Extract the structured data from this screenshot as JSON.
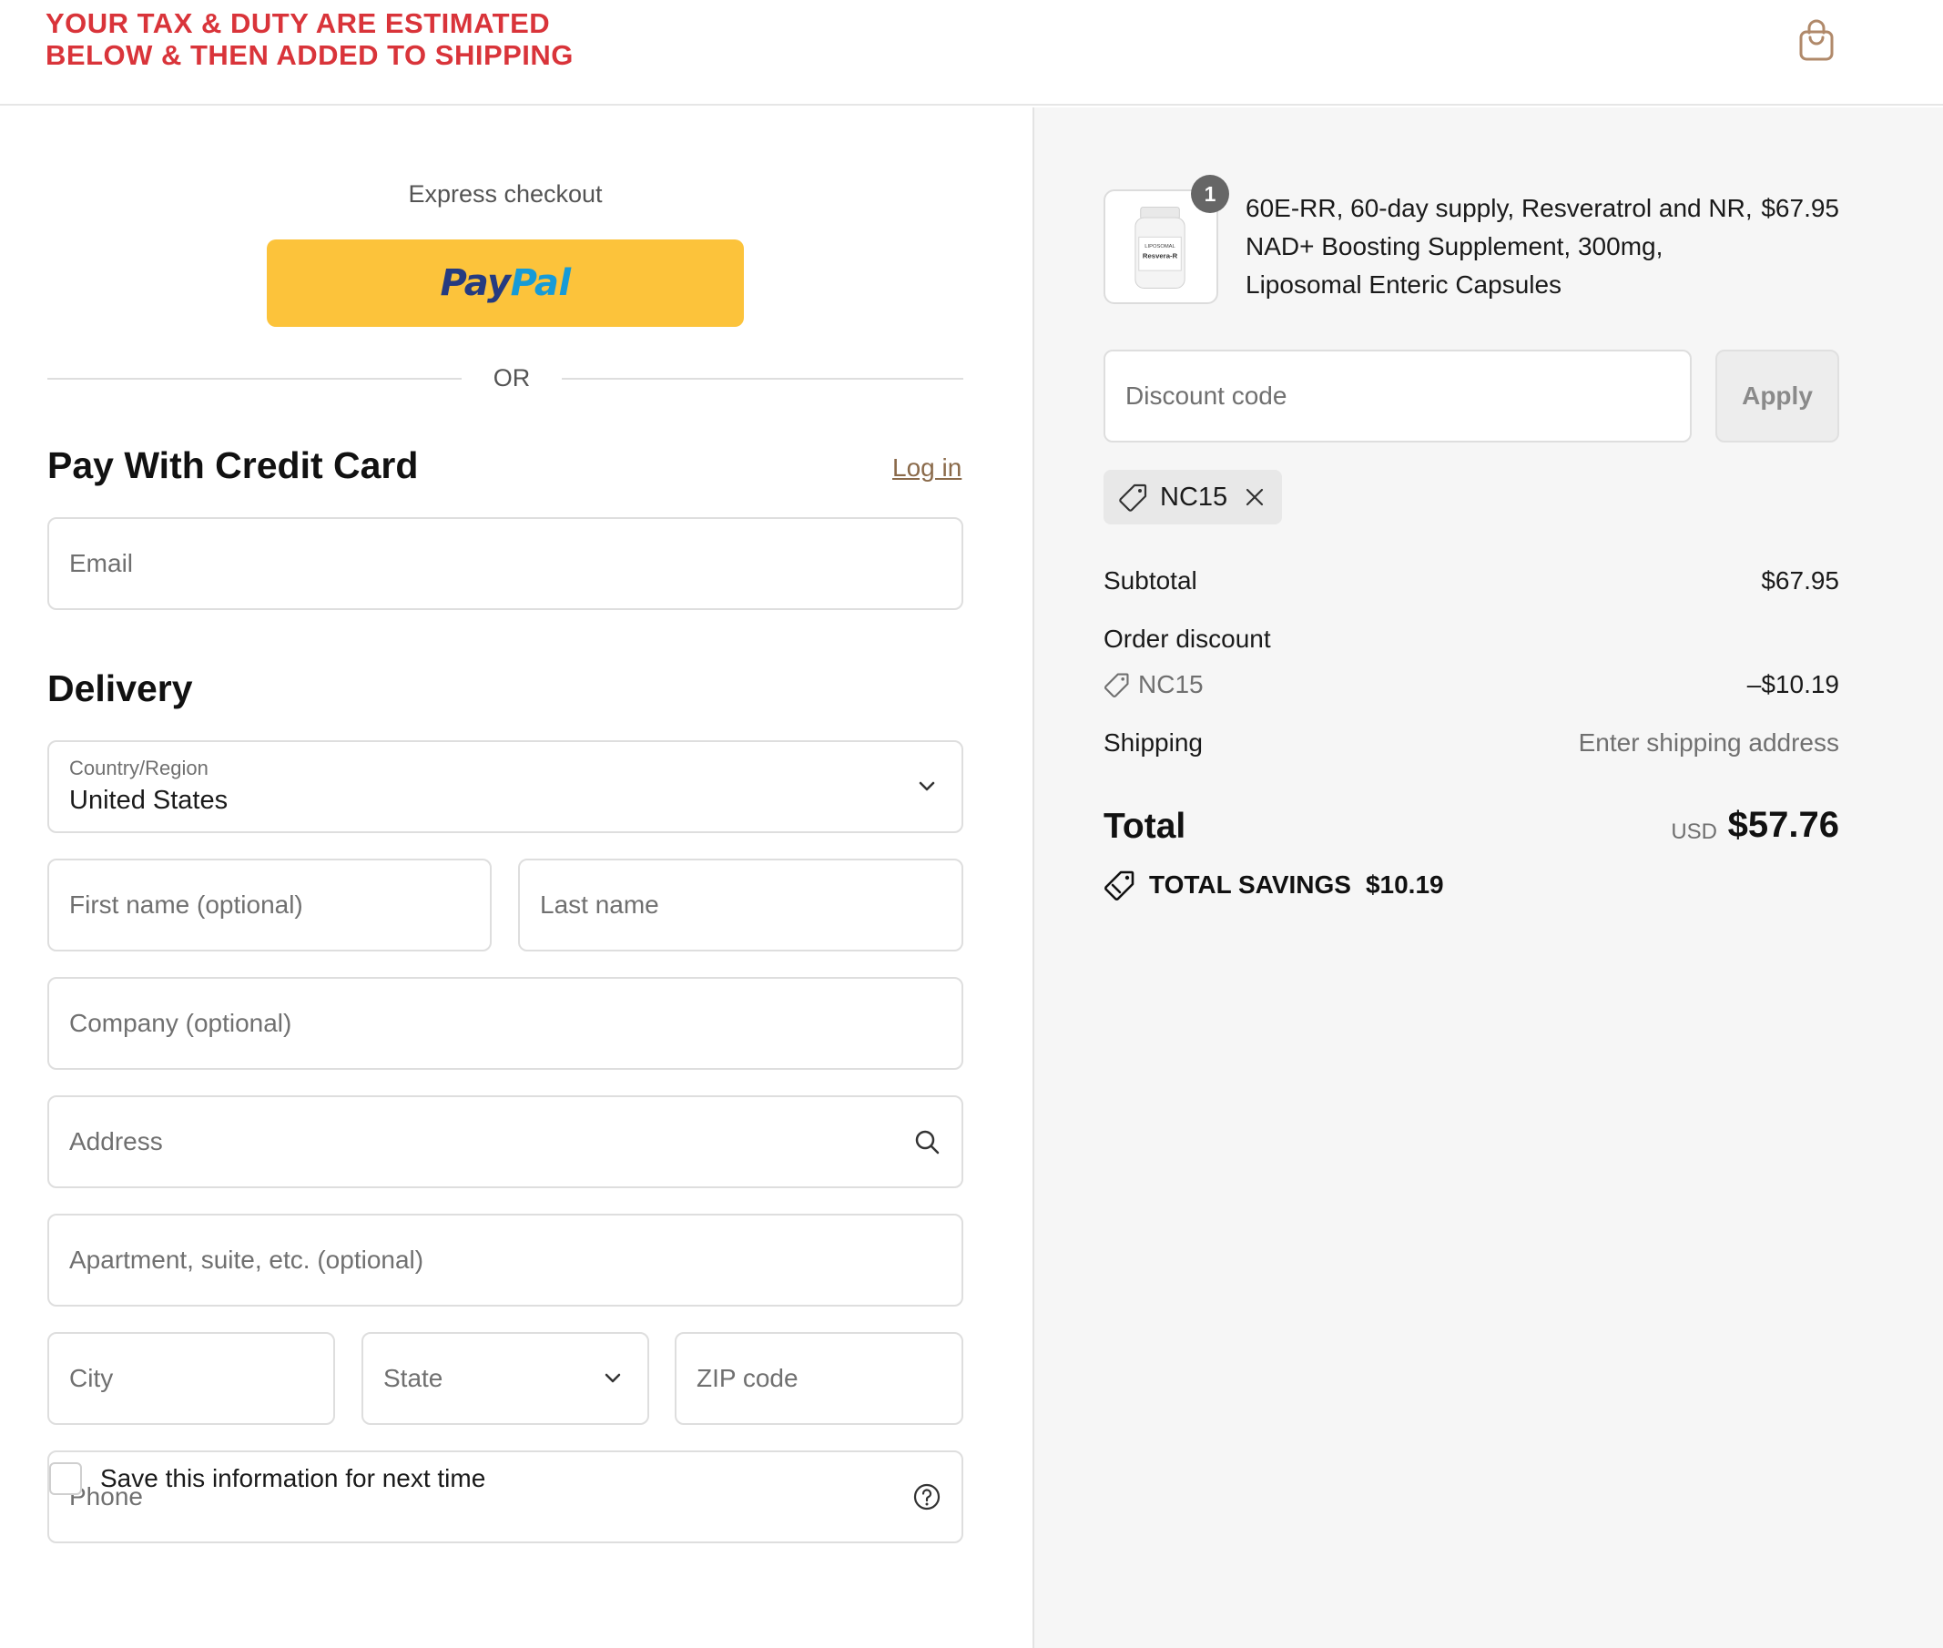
{
  "header": {
    "banner_line1": "YOUR TAX & DUTY ARE ESTIMATED",
    "banner_line2": "BELOW & THEN ADDED TO SHIPPING",
    "cart_icon": "shopping-bag-icon"
  },
  "checkout": {
    "express_label": "Express checkout",
    "paypal_pay": "Pay",
    "paypal_pal": "Pal",
    "or_label": "OR",
    "pay_title": "Pay With Credit Card",
    "login_label": "Log in",
    "email_placeholder": "Email",
    "delivery_title": "Delivery",
    "country_label": "Country/Region",
    "country_value": "United States",
    "first_name_placeholder": "First name (optional)",
    "last_name_placeholder": "Last name",
    "company_placeholder": "Company (optional)",
    "address_placeholder": "Address",
    "apartment_placeholder": "Apartment, suite, etc. (optional)",
    "city_placeholder": "City",
    "state_placeholder": "State",
    "zip_placeholder": "ZIP code",
    "phone_placeholder": "Phone",
    "save_info_label": "Save this information for next time",
    "save_info_checked": false
  },
  "summary": {
    "product": {
      "quantity": "1",
      "name": "60E-RR, 60-day supply, Resveratrol and NR, NAD+ Boosting Supplement, 300mg, Liposomal Enteric Capsules",
      "price": "$67.95",
      "bottle_label_line1": "LIPOSOMAL",
      "bottle_label_line2": "Resvera-R"
    },
    "discount_placeholder": "Discount code",
    "apply_label": "Apply",
    "applied_code": "NC15",
    "subtotal_label": "Subtotal",
    "subtotal_value": "$67.95",
    "order_discount_label": "Order discount",
    "discount_code_line": "NC15",
    "discount_value": "–$10.19",
    "shipping_label": "Shipping",
    "shipping_value": "Enter shipping address",
    "total_label": "Total",
    "total_currency": "USD",
    "total_value": "$57.76",
    "savings_label": "TOTAL SAVINGS",
    "savings_value": "$10.19"
  },
  "colors": {
    "banner": "#d9343a",
    "paypal_yellow": "#fcc33b",
    "paypal_dark_blue": "#253b80",
    "paypal_light_blue": "#179bd7",
    "summary_bg": "#f6f6f6"
  }
}
